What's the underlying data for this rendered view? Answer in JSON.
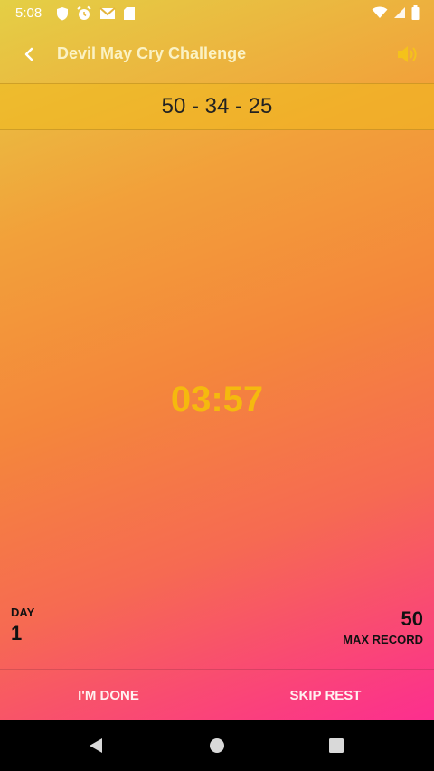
{
  "status_bar": {
    "time": "5:08",
    "icons": [
      "shield-icon",
      "alarm-icon",
      "gmail-icon",
      "sd-card-icon",
      "wifi-icon",
      "signal-icon",
      "battery-icon"
    ]
  },
  "app_bar": {
    "title": "Devil May Cry Challenge",
    "back_icon": "chevron-left-icon",
    "sound_icon": "volume-icon"
  },
  "sets": "50 - 34 - 25",
  "timer": "03:57",
  "stats": {
    "day_label": "DAY",
    "day_value": "1",
    "max_value": "50",
    "max_label": "MAX RECORD"
  },
  "actions": {
    "done_label": "I'M DONE",
    "skip_label": "SKIP REST"
  },
  "colors": {
    "timer": "#f5b90e",
    "gradient_top": "#e4cf45",
    "gradient_bottom": "#fc2e8f"
  }
}
